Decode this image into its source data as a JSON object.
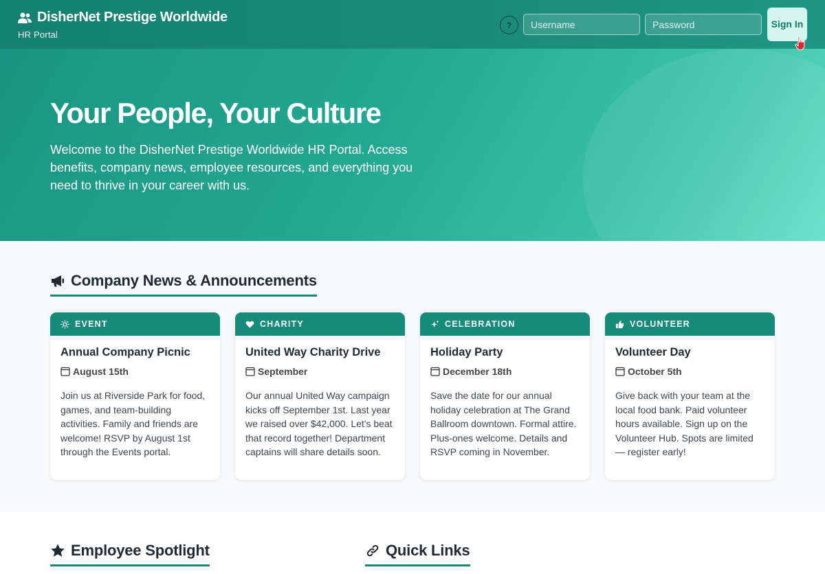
{
  "header": {
    "brand_name": "DisherNet Prestige Worldwide",
    "brand_sub": "HR Portal",
    "help_label": "?",
    "username_placeholder": "Username",
    "password_placeholder": "Password",
    "signin_label": "Sign In"
  },
  "hero": {
    "title": "Your People, Your Culture",
    "text": "Welcome to the DisherNet Prestige Worldwide HR Portal. Access benefits, company news, employee resources, and everything you need to thrive in your career with us."
  },
  "news": {
    "title": "Company News & Announcements",
    "cards": [
      {
        "tag": "EVENT",
        "icon": "sun-icon",
        "title": "Annual Company Picnic",
        "date": "August 15th",
        "body": "Join us at Riverside Park for food, games, and team-building activities. Family and friends are welcome! RSVP by August 1st through the Events portal."
      },
      {
        "tag": "CHARITY",
        "icon": "heart-icon",
        "title": "United Way Charity Drive",
        "date": "September",
        "body": "Our annual United Way campaign kicks off September 1st. Last year we raised over $42,000. Let's beat that record together! Department captains will share details soon."
      },
      {
        "tag": "CELEBRATION",
        "icon": "sparkle-icon",
        "title": "Holiday Party",
        "date": "December 18th",
        "body": "Save the date for our annual holiday celebration at The Grand Ballroom downtown. Formal attire. Plus-ones welcome. Details and RSVP coming in November."
      },
      {
        "tag": "VOLUNTEER",
        "icon": "thumbs-up-icon",
        "title": "Volunteer Day",
        "date": "October 5th",
        "body": "Give back with your team at the local food bank. Paid volunteer hours available. Sign up on the Volunteer Hub. Spots are limited — register early!"
      }
    ]
  },
  "spotlight": {
    "title": "Employee Spotlight"
  },
  "quick_links": {
    "title": "Quick Links"
  },
  "colors": {
    "primary": "#168a7b",
    "hero_light": "#62e0c8",
    "signin_bg": "#d4f5ee"
  }
}
